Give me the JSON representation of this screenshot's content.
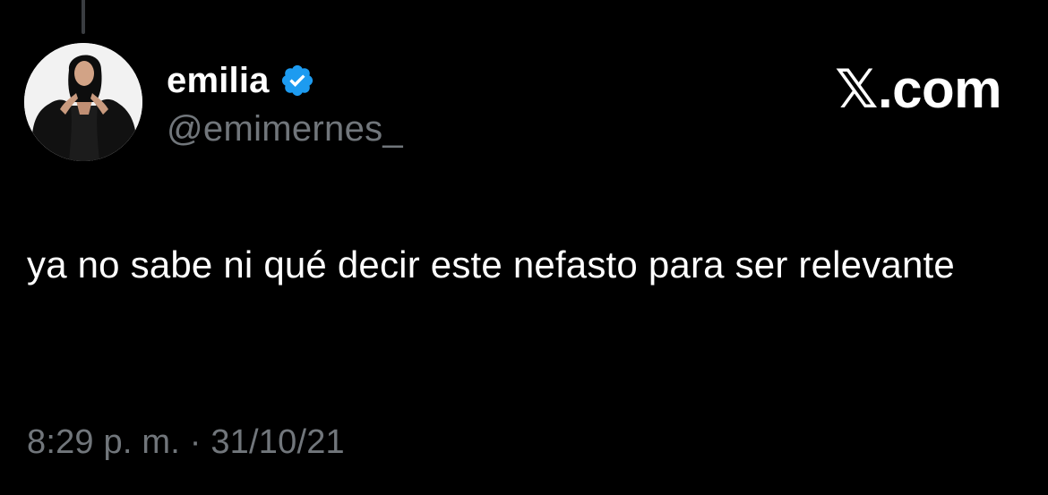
{
  "tweet": {
    "author": {
      "display_name": "emilia",
      "handle": "@emimernes_",
      "verified": true
    },
    "brand": "𝕏.com",
    "text": "ya no sabe ni qué decir este nefasto para ser relevante",
    "timestamp": "8:29 p. m. · 31/10/21"
  },
  "colors": {
    "background": "#000000",
    "primary_text": "#ffffff",
    "secondary_text": "#71767b",
    "verified_badge": "#1d9bf0"
  },
  "icons": {
    "verified": "verified-badge-icon",
    "avatar": "profile-photo"
  }
}
